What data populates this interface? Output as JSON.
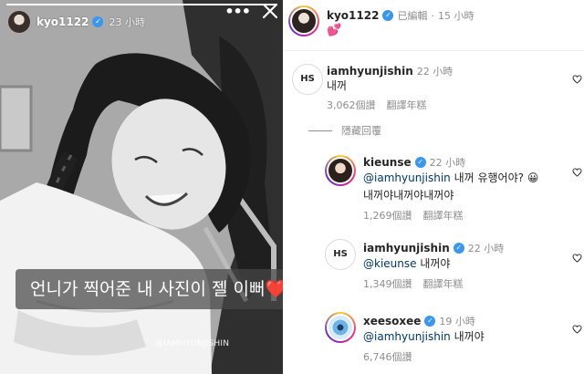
{
  "story": {
    "username": "kyo1122",
    "time": "23 小時",
    "more_icon": "more-horizontal-icon",
    "close_icon": "close-icon",
    "progress": 1.0,
    "caption": "언니가 찍어준 내 사진이 젤 이뻐❤️",
    "watermark": "@IAMHYUNJISHIN"
  },
  "post": {
    "username": "kyo1122",
    "edited": "已編輯",
    "dot": "·",
    "time": "15 小時",
    "caption": "💕"
  },
  "comments": [
    {
      "avatar_text": "HS",
      "username": "iamhyunjishin",
      "time": "22 小時",
      "text": "내꺼",
      "likes": "3,062個讚",
      "translate": "翻譯年糕"
    }
  ],
  "hidden_replies": "隱藏回覆",
  "replies": [
    {
      "username": "kieunse",
      "time": "22 小時",
      "mention": "@iamhyunjishin",
      "text_after": " 내꺼 유행어야? 😀",
      "text_line2": "내꺼야내꺼야내꺼야",
      "likes": "1,269個讚",
      "translate": "翻譯年糕"
    },
    {
      "avatar_text": "HS",
      "username": "iamhyunjishin",
      "time": "22 小時",
      "mention": "@kieunse",
      "text_after": " 내꺼야",
      "likes": "1,349個讚",
      "translate": "翻譯年糕"
    },
    {
      "username": "xeesoxee",
      "time": "19 小時",
      "mention": "@iamhyunjishin",
      "text_after": " 내꺼야",
      "likes": "6,746個讚"
    }
  ],
  "colors": {
    "verified": "#3897f0",
    "secondary_text": "#8e8e8e",
    "mention": "#00376b",
    "story_caption_bg": "#464646"
  }
}
